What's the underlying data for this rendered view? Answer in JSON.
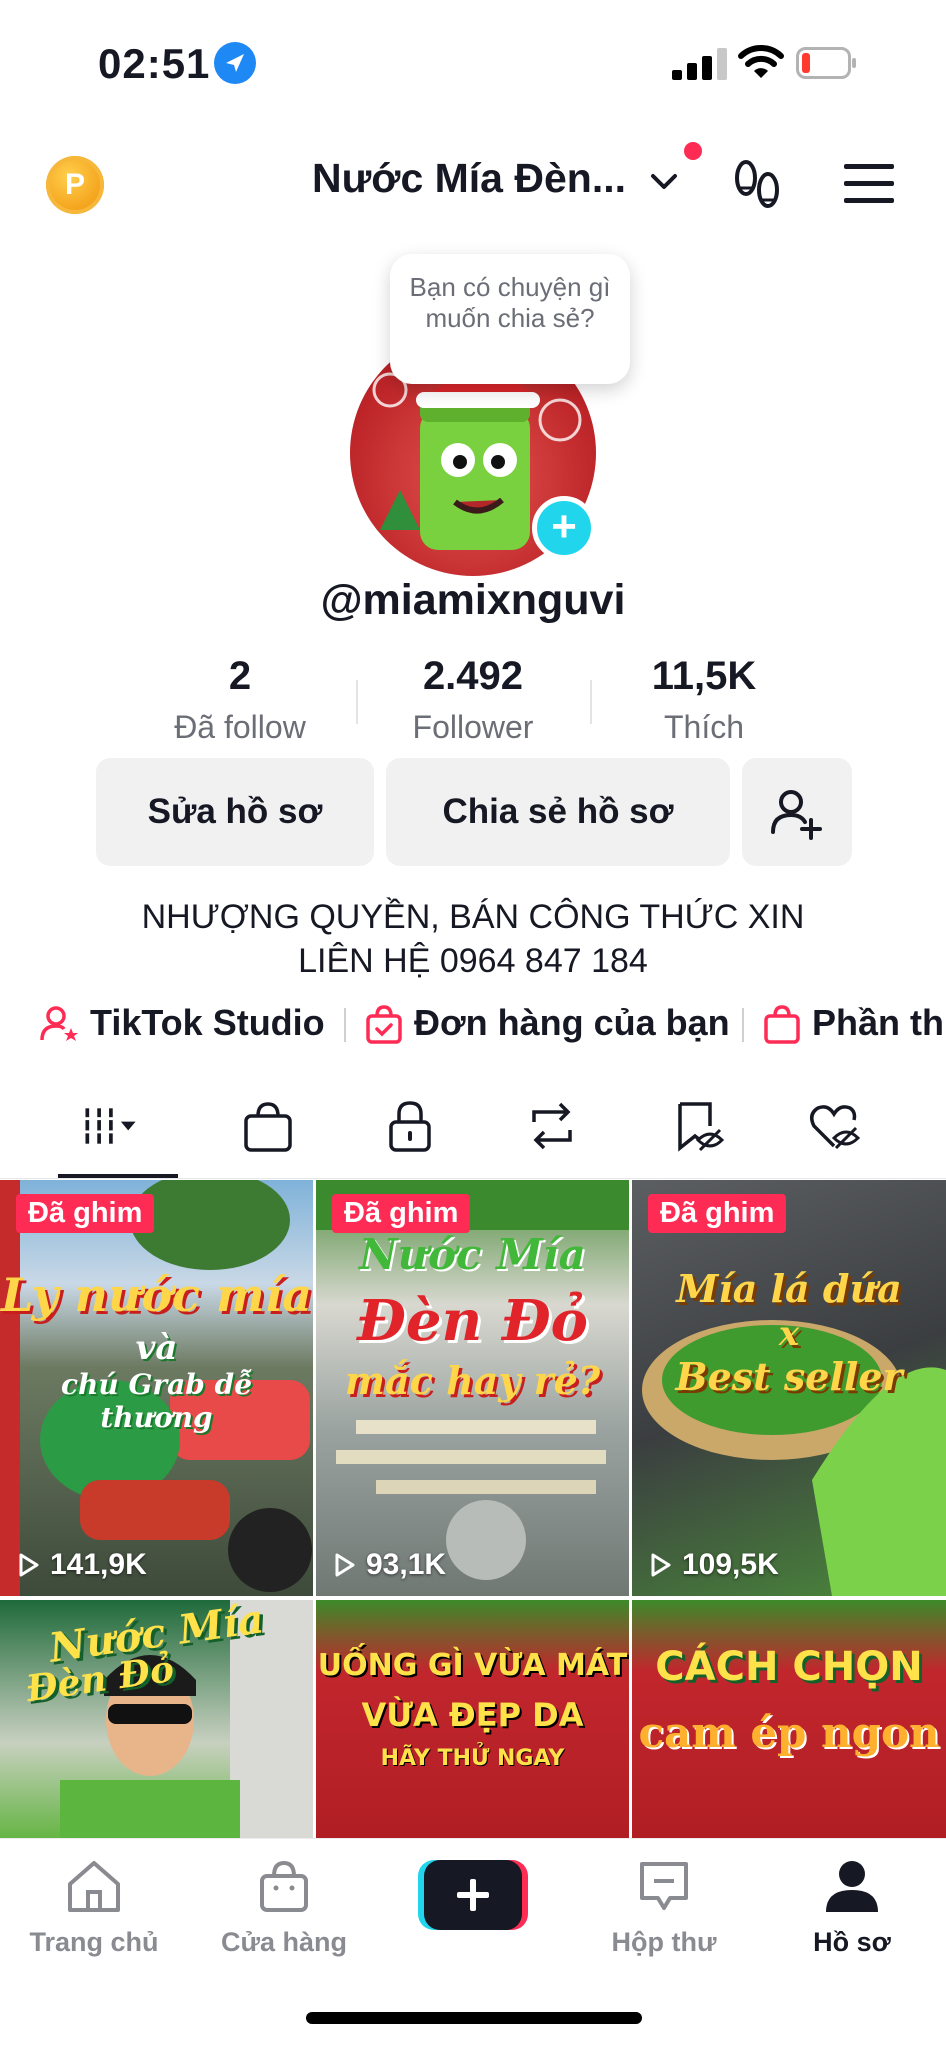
{
  "status_bar": {
    "time": "02:51"
  },
  "header": {
    "coin_letter": "P",
    "title": "Nước Mía Đèn..."
  },
  "profile": {
    "bubble_text": "Bạn có chuyện gì muốn chia sẻ?",
    "username": "@miamixnguvi",
    "stats": [
      {
        "value": "2",
        "label": "Đã follow"
      },
      {
        "value": "2.492",
        "label": "Follower"
      },
      {
        "value": "11,5K",
        "label": "Thích"
      }
    ],
    "buttons": {
      "edit": "Sửa hồ sơ",
      "share": "Chia sẻ hồ sơ"
    },
    "bio_line1": "NHƯỢNG QUYỀN, BÁN CÔNG THỨC XIN",
    "bio_line2": "LIÊN HỆ 0964 847 184",
    "links": [
      "TikTok Studio",
      "Đơn hàng của bạn",
      "Phần thưởng"
    ]
  },
  "videos": [
    {
      "pinned_label": "Đã ghim",
      "views": "141,9K",
      "caption": [
        "Ly nước mía",
        "và",
        "chú Grab dễ thương"
      ]
    },
    {
      "pinned_label": "Đã ghim",
      "views": "93,1K",
      "caption": [
        "Nước Mía",
        "Đèn Đỏ",
        "mắc hay rẻ?"
      ]
    },
    {
      "pinned_label": "Đã ghim",
      "views": "109,5K",
      "caption": [
        "Mía lá dứa",
        "x",
        "Best seller"
      ]
    },
    {
      "caption": [
        "Nước Mía",
        "Đèn Đỏ"
      ]
    },
    {
      "caption": [
        "UỐNG GÌ VỪA MÁT",
        "VỪA ĐẸP DA",
        "HÃY THỬ NGAY"
      ]
    },
    {
      "caption": [
        "CÁCH CHỌN",
        "cam ép ngon"
      ]
    }
  ],
  "bottom_nav": [
    {
      "label": "Trang chủ"
    },
    {
      "label": "Cửa hàng"
    },
    {
      "label": "Hộp thư"
    },
    {
      "label": "Hồ sơ"
    }
  ],
  "colors": {
    "accent": "#fe2c55",
    "cyan": "#20d5ec",
    "text": "#161823",
    "muted": "#6b6e76"
  }
}
